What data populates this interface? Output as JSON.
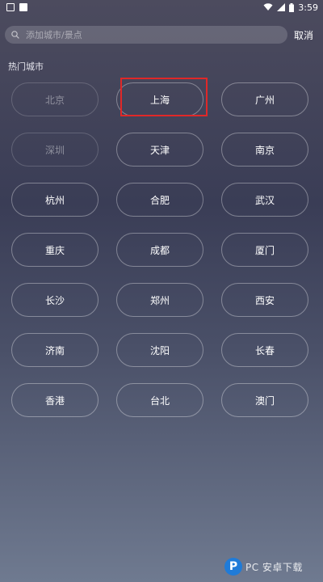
{
  "status_bar": {
    "time": "3:59",
    "icons": [
      "notification-square-icon",
      "notification-square-icon",
      "wifi-icon",
      "signal-icon",
      "battery-icon"
    ]
  },
  "search": {
    "placeholder": "添加城市/景点",
    "value": "",
    "cancel_label": "取消"
  },
  "hot_cities": {
    "title": "热门城市",
    "cities": [
      {
        "name": "北京",
        "state": "disabled"
      },
      {
        "name": "上海",
        "state": "highlighted"
      },
      {
        "name": "广州",
        "state": "normal"
      },
      {
        "name": "深圳",
        "state": "disabled"
      },
      {
        "name": "天津",
        "state": "normal"
      },
      {
        "name": "南京",
        "state": "normal"
      },
      {
        "name": "杭州",
        "state": "normal"
      },
      {
        "name": "合肥",
        "state": "normal"
      },
      {
        "name": "武汉",
        "state": "normal"
      },
      {
        "name": "重庆",
        "state": "normal"
      },
      {
        "name": "成都",
        "state": "normal"
      },
      {
        "name": "厦门",
        "state": "normal"
      },
      {
        "name": "长沙",
        "state": "normal"
      },
      {
        "name": "郑州",
        "state": "normal"
      },
      {
        "name": "西安",
        "state": "normal"
      },
      {
        "name": "济南",
        "state": "normal"
      },
      {
        "name": "沈阳",
        "state": "normal"
      },
      {
        "name": "长春",
        "state": "normal"
      },
      {
        "name": "香港",
        "state": "normal"
      },
      {
        "name": "台北",
        "state": "normal"
      },
      {
        "name": "澳门",
        "state": "normal"
      }
    ]
  },
  "colors": {
    "highlight": "#e02828",
    "watermark_logo": "#1f7bd8"
  },
  "watermark": {
    "logo_letter": "P",
    "text": "PC 安卓下载"
  }
}
